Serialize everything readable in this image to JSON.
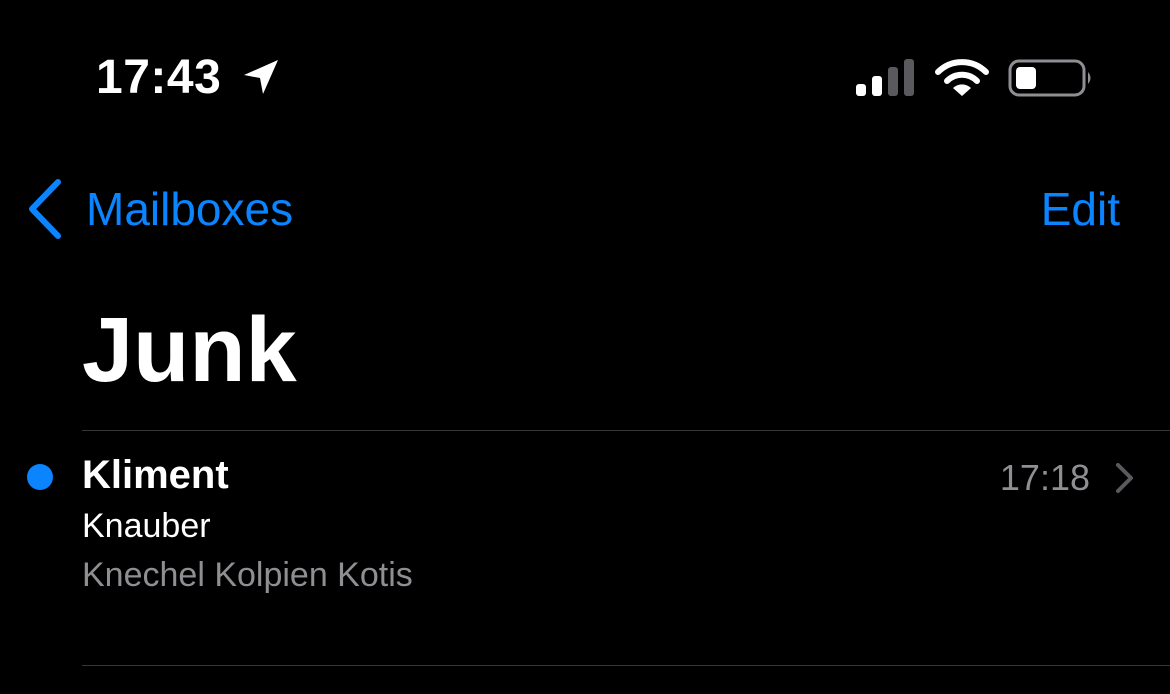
{
  "status_bar": {
    "time": "17:43",
    "icons": [
      "location-arrow-icon",
      "cellular-signal-icon",
      "wifi-icon",
      "battery-icon"
    ]
  },
  "nav": {
    "back_label": "Mailboxes",
    "edit_label": "Edit"
  },
  "mailbox": {
    "title": "Junk"
  },
  "messages": [
    {
      "sender": "Kliment",
      "subject": "Knauber",
      "preview": "Knechel Kolpien Kotis",
      "time": "17:18",
      "unread": true
    }
  ],
  "colors": {
    "accent": "#0a84ff",
    "background": "#000000",
    "secondary_text": "#8e8e93",
    "separator": "#38383a"
  }
}
